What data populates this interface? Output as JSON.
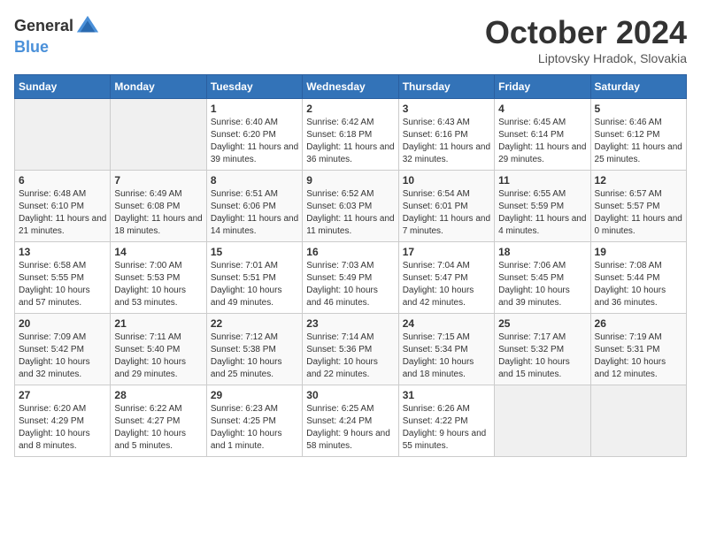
{
  "header": {
    "logo_general": "General",
    "logo_blue": "Blue",
    "month": "October 2024",
    "location": "Liptovsky Hradok, Slovakia"
  },
  "weekdays": [
    "Sunday",
    "Monday",
    "Tuesday",
    "Wednesday",
    "Thursday",
    "Friday",
    "Saturday"
  ],
  "weeks": [
    [
      {
        "day": "",
        "sunrise": "",
        "sunset": "",
        "daylight": ""
      },
      {
        "day": "",
        "sunrise": "",
        "sunset": "",
        "daylight": ""
      },
      {
        "day": "1",
        "sunrise": "Sunrise: 6:40 AM",
        "sunset": "Sunset: 6:20 PM",
        "daylight": "Daylight: 11 hours and 39 minutes."
      },
      {
        "day": "2",
        "sunrise": "Sunrise: 6:42 AM",
        "sunset": "Sunset: 6:18 PM",
        "daylight": "Daylight: 11 hours and 36 minutes."
      },
      {
        "day": "3",
        "sunrise": "Sunrise: 6:43 AM",
        "sunset": "Sunset: 6:16 PM",
        "daylight": "Daylight: 11 hours and 32 minutes."
      },
      {
        "day": "4",
        "sunrise": "Sunrise: 6:45 AM",
        "sunset": "Sunset: 6:14 PM",
        "daylight": "Daylight: 11 hours and 29 minutes."
      },
      {
        "day": "5",
        "sunrise": "Sunrise: 6:46 AM",
        "sunset": "Sunset: 6:12 PM",
        "daylight": "Daylight: 11 hours and 25 minutes."
      }
    ],
    [
      {
        "day": "6",
        "sunrise": "Sunrise: 6:48 AM",
        "sunset": "Sunset: 6:10 PM",
        "daylight": "Daylight: 11 hours and 21 minutes."
      },
      {
        "day": "7",
        "sunrise": "Sunrise: 6:49 AM",
        "sunset": "Sunset: 6:08 PM",
        "daylight": "Daylight: 11 hours and 18 minutes."
      },
      {
        "day": "8",
        "sunrise": "Sunrise: 6:51 AM",
        "sunset": "Sunset: 6:06 PM",
        "daylight": "Daylight: 11 hours and 14 minutes."
      },
      {
        "day": "9",
        "sunrise": "Sunrise: 6:52 AM",
        "sunset": "Sunset: 6:03 PM",
        "daylight": "Daylight: 11 hours and 11 minutes."
      },
      {
        "day": "10",
        "sunrise": "Sunrise: 6:54 AM",
        "sunset": "Sunset: 6:01 PM",
        "daylight": "Daylight: 11 hours and 7 minutes."
      },
      {
        "day": "11",
        "sunrise": "Sunrise: 6:55 AM",
        "sunset": "Sunset: 5:59 PM",
        "daylight": "Daylight: 11 hours and 4 minutes."
      },
      {
        "day": "12",
        "sunrise": "Sunrise: 6:57 AM",
        "sunset": "Sunset: 5:57 PM",
        "daylight": "Daylight: 11 hours and 0 minutes."
      }
    ],
    [
      {
        "day": "13",
        "sunrise": "Sunrise: 6:58 AM",
        "sunset": "Sunset: 5:55 PM",
        "daylight": "Daylight: 10 hours and 57 minutes."
      },
      {
        "day": "14",
        "sunrise": "Sunrise: 7:00 AM",
        "sunset": "Sunset: 5:53 PM",
        "daylight": "Daylight: 10 hours and 53 minutes."
      },
      {
        "day": "15",
        "sunrise": "Sunrise: 7:01 AM",
        "sunset": "Sunset: 5:51 PM",
        "daylight": "Daylight: 10 hours and 49 minutes."
      },
      {
        "day": "16",
        "sunrise": "Sunrise: 7:03 AM",
        "sunset": "Sunset: 5:49 PM",
        "daylight": "Daylight: 10 hours and 46 minutes."
      },
      {
        "day": "17",
        "sunrise": "Sunrise: 7:04 AM",
        "sunset": "Sunset: 5:47 PM",
        "daylight": "Daylight: 10 hours and 42 minutes."
      },
      {
        "day": "18",
        "sunrise": "Sunrise: 7:06 AM",
        "sunset": "Sunset: 5:45 PM",
        "daylight": "Daylight: 10 hours and 39 minutes."
      },
      {
        "day": "19",
        "sunrise": "Sunrise: 7:08 AM",
        "sunset": "Sunset: 5:44 PM",
        "daylight": "Daylight: 10 hours and 36 minutes."
      }
    ],
    [
      {
        "day": "20",
        "sunrise": "Sunrise: 7:09 AM",
        "sunset": "Sunset: 5:42 PM",
        "daylight": "Daylight: 10 hours and 32 minutes."
      },
      {
        "day": "21",
        "sunrise": "Sunrise: 7:11 AM",
        "sunset": "Sunset: 5:40 PM",
        "daylight": "Daylight: 10 hours and 29 minutes."
      },
      {
        "day": "22",
        "sunrise": "Sunrise: 7:12 AM",
        "sunset": "Sunset: 5:38 PM",
        "daylight": "Daylight: 10 hours and 25 minutes."
      },
      {
        "day": "23",
        "sunrise": "Sunrise: 7:14 AM",
        "sunset": "Sunset: 5:36 PM",
        "daylight": "Daylight: 10 hours and 22 minutes."
      },
      {
        "day": "24",
        "sunrise": "Sunrise: 7:15 AM",
        "sunset": "Sunset: 5:34 PM",
        "daylight": "Daylight: 10 hours and 18 minutes."
      },
      {
        "day": "25",
        "sunrise": "Sunrise: 7:17 AM",
        "sunset": "Sunset: 5:32 PM",
        "daylight": "Daylight: 10 hours and 15 minutes."
      },
      {
        "day": "26",
        "sunrise": "Sunrise: 7:19 AM",
        "sunset": "Sunset: 5:31 PM",
        "daylight": "Daylight: 10 hours and 12 minutes."
      }
    ],
    [
      {
        "day": "27",
        "sunrise": "Sunrise: 6:20 AM",
        "sunset": "Sunset: 4:29 PM",
        "daylight": "Daylight: 10 hours and 8 minutes."
      },
      {
        "day": "28",
        "sunrise": "Sunrise: 6:22 AM",
        "sunset": "Sunset: 4:27 PM",
        "daylight": "Daylight: 10 hours and 5 minutes."
      },
      {
        "day": "29",
        "sunrise": "Sunrise: 6:23 AM",
        "sunset": "Sunset: 4:25 PM",
        "daylight": "Daylight: 10 hours and 1 minute."
      },
      {
        "day": "30",
        "sunrise": "Sunrise: 6:25 AM",
        "sunset": "Sunset: 4:24 PM",
        "daylight": "Daylight: 9 hours and 58 minutes."
      },
      {
        "day": "31",
        "sunrise": "Sunrise: 6:26 AM",
        "sunset": "Sunset: 4:22 PM",
        "daylight": "Daylight: 9 hours and 55 minutes."
      },
      {
        "day": "",
        "sunrise": "",
        "sunset": "",
        "daylight": ""
      },
      {
        "day": "",
        "sunrise": "",
        "sunset": "",
        "daylight": ""
      }
    ]
  ]
}
